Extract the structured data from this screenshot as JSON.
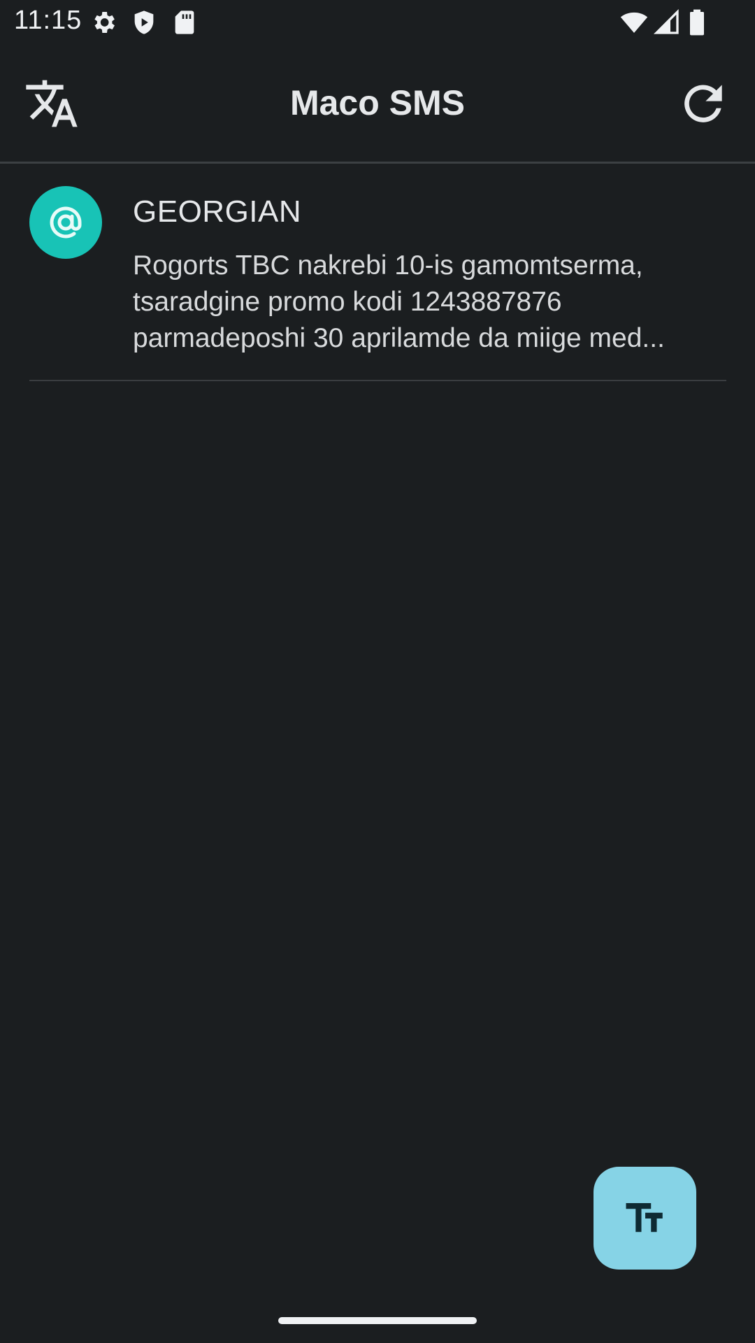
{
  "status_bar": {
    "time": "11:15",
    "left_icons": [
      "settings-icon",
      "shield-icon",
      "sd-card-icon"
    ],
    "right_icons": [
      "wifi-icon",
      "cellular-signal-icon",
      "battery-icon"
    ]
  },
  "app_bar": {
    "title": "Maco SMS",
    "left_icon": "translate-icon",
    "right_icon": "refresh-icon"
  },
  "messages": [
    {
      "avatar_icon": "at-sign-icon",
      "avatar_color": "#18c3b6",
      "sender": "GEORGIAN",
      "preview": "Rogorts TBC nakrebi 10-is gamomtserma, tsaradgine promo kodi 1243887876 parmadeposhi 30 aprilamde da miige med..."
    }
  ],
  "fab": {
    "icon": "text-size-icon",
    "color": "#86d3e6"
  },
  "colors": {
    "background": "#1b1e20",
    "accent": "#18c3b6"
  }
}
